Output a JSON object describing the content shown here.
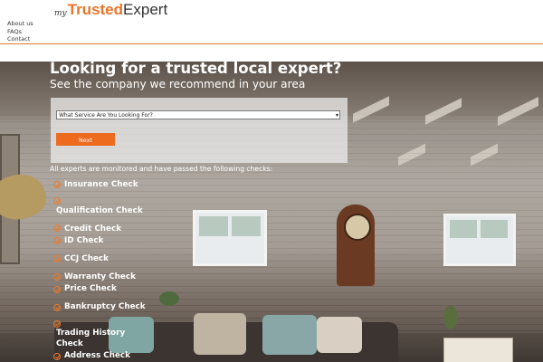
{
  "logo": {
    "my": "my",
    "trusted": "Trusted",
    "expert": "Expert"
  },
  "nav": {
    "items": [
      "About us",
      "FAQs",
      "Contact"
    ]
  },
  "hero": {
    "headline": "Looking for a trusted local expert?",
    "subhead": "See the company we recommend in your area"
  },
  "form": {
    "select_value": "What Service Are You Looking For?",
    "next_label": "Next"
  },
  "checks": {
    "intro": "All experts are monitored and have passed the following checks:",
    "items": [
      "Insurance Check",
      "Qualification Check",
      "Credit Check",
      "ID Check",
      "CCJ Check",
      "Warranty Check",
      "Price Check",
      "Bankruptcy Check",
      "Trading History Check",
      "Address Check"
    ]
  },
  "colors": {
    "accent": "#ec6b1f",
    "text_dark": "#333333"
  }
}
